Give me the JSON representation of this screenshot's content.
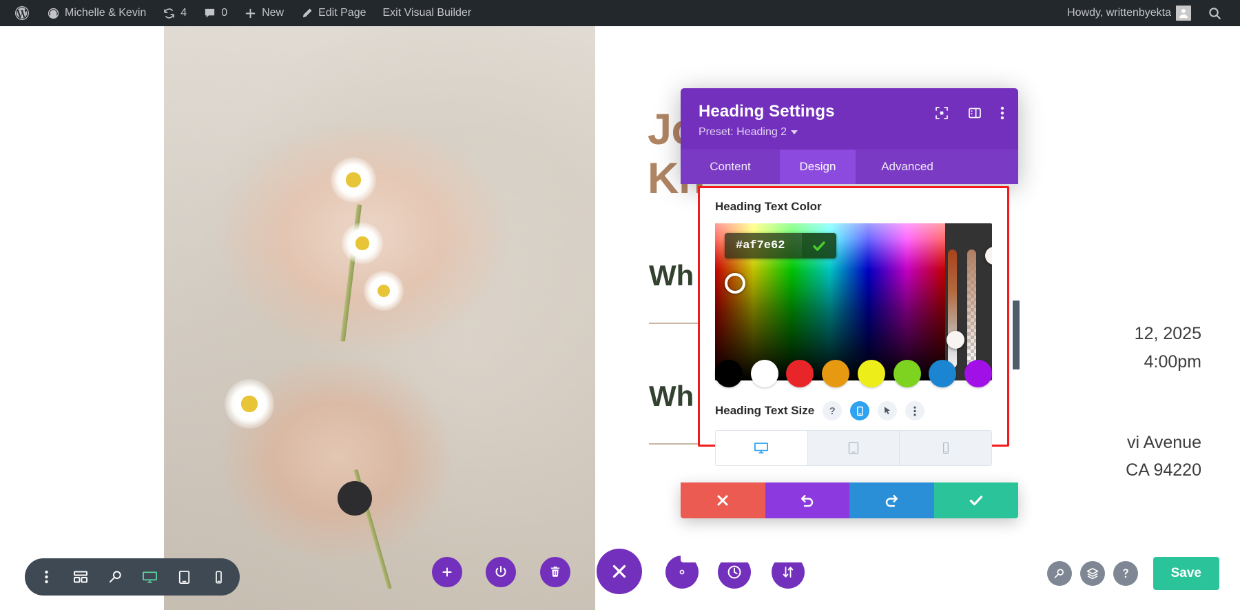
{
  "adminbar": {
    "site_name": "Michelle & Kevin",
    "revisions_count": "4",
    "comments_count": "0",
    "new_label": "New",
    "edit_page_label": "Edit Page",
    "exit_builder_label": "Exit Visual Builder",
    "howdy": "Howdy, writtenbyekta",
    "icons": {
      "wp_logo": "wordpress-logo-icon",
      "dashboard": "dashboard-icon",
      "revisions": "revisions-icon",
      "comments": "comments-icon",
      "new": "plus-icon",
      "edit": "pencil-icon",
      "avatar": "avatar-icon",
      "search": "search-icon"
    }
  },
  "page": {
    "hero_heading": "Jo                 e\nKn",
    "heading_two_a": "Wh",
    "heading_two_b": "Wh",
    "detail_date": "12, 2025",
    "detail_time": "4:00pm",
    "detail_street": "vi Avenue",
    "detail_citystate": "CA 94220"
  },
  "modal": {
    "title": "Heading Settings",
    "preset_label": "Preset: Heading 2",
    "header_icons": [
      {
        "name": "focus-module-icon"
      },
      {
        "name": "panel-layout-icon"
      },
      {
        "name": "more-options-icon"
      }
    ],
    "tabs": [
      {
        "label": "Content",
        "active": false
      },
      {
        "label": "Design",
        "active": true
      },
      {
        "label": "Advanced",
        "active": false
      }
    ],
    "color_field": {
      "label": "Heading Text Color",
      "hex_value": "#af7e62",
      "confirm_icon": "checkmark-icon",
      "swatches": [
        {
          "name": "swatch-black",
          "hex": "#000000"
        },
        {
          "name": "swatch-white",
          "hex": "#ffffff"
        },
        {
          "name": "swatch-red",
          "hex": "#e8262a"
        },
        {
          "name": "swatch-orange",
          "hex": "#e79a11"
        },
        {
          "name": "swatch-yellow",
          "hex": "#eded1a"
        },
        {
          "name": "swatch-green",
          "hex": "#7ed321"
        },
        {
          "name": "swatch-blue",
          "hex": "#1b85d1"
        },
        {
          "name": "swatch-purple",
          "hex": "#a210e8"
        }
      ]
    },
    "size_field": {
      "label": "Heading Text Size",
      "controls": [
        {
          "name": "help-button",
          "glyph": "?",
          "active": false
        },
        {
          "name": "responsive-button",
          "glyph": "responsive-icon",
          "active": true
        },
        {
          "name": "hover-button",
          "glyph": "cursor-icon",
          "active": false
        },
        {
          "name": "more-button",
          "glyph": "more-options-icon",
          "active": false
        }
      ],
      "devices": [
        {
          "name": "device-desktop",
          "icon": "desktop-icon",
          "active": true
        },
        {
          "name": "device-tablet",
          "icon": "tablet-icon",
          "active": false
        },
        {
          "name": "device-phone",
          "icon": "phone-icon",
          "active": false
        }
      ]
    },
    "actions": [
      {
        "name": "cancel-button",
        "icon": "close-icon",
        "color": "#eb5b51"
      },
      {
        "name": "undo-button",
        "icon": "undo-icon",
        "color": "#8c3ae0"
      },
      {
        "name": "redo-button",
        "icon": "redo-icon",
        "color": "#2a8fd6"
      },
      {
        "name": "save-settings-button",
        "icon": "checkmark-icon",
        "color": "#2bc39a"
      }
    ]
  },
  "builder_bar": {
    "left_tools": [
      {
        "name": "more-options-icon",
        "active": false
      },
      {
        "name": "wireframe-view-icon",
        "active": false
      },
      {
        "name": "zoom-out-view-icon",
        "active": false
      },
      {
        "name": "desktop-view-icon",
        "active": true
      },
      {
        "name": "tablet-view-icon",
        "active": false
      },
      {
        "name": "phone-view-icon",
        "active": false
      }
    ],
    "center_tools": [
      {
        "name": "add-module-button",
        "icon": "plus-icon"
      },
      {
        "name": "toggle-builder-button",
        "icon": "power-icon"
      },
      {
        "name": "delete-button",
        "icon": "trash-icon"
      },
      {
        "name": "close-menu-button",
        "icon": "close-icon"
      },
      {
        "name": "settings-button",
        "icon": "gear-icon"
      },
      {
        "name": "history-button",
        "icon": "clock-icon"
      },
      {
        "name": "reorder-button",
        "icon": "sort-arrows-icon"
      }
    ],
    "right_tools": [
      {
        "name": "search-button",
        "icon": "search-icon"
      },
      {
        "name": "layers-button",
        "icon": "layers-icon"
      },
      {
        "name": "help-button",
        "icon": "help-icon"
      }
    ],
    "save_label": "Save"
  },
  "colors": {
    "admin_bar": "#23282d",
    "modal_purple": "#7330bd",
    "tab_active": "#8c4ade",
    "highlight_red": "#f21a1a",
    "save_green": "#2bc39a",
    "heading_brown": "#b08564",
    "heading_green": "#33412f"
  }
}
